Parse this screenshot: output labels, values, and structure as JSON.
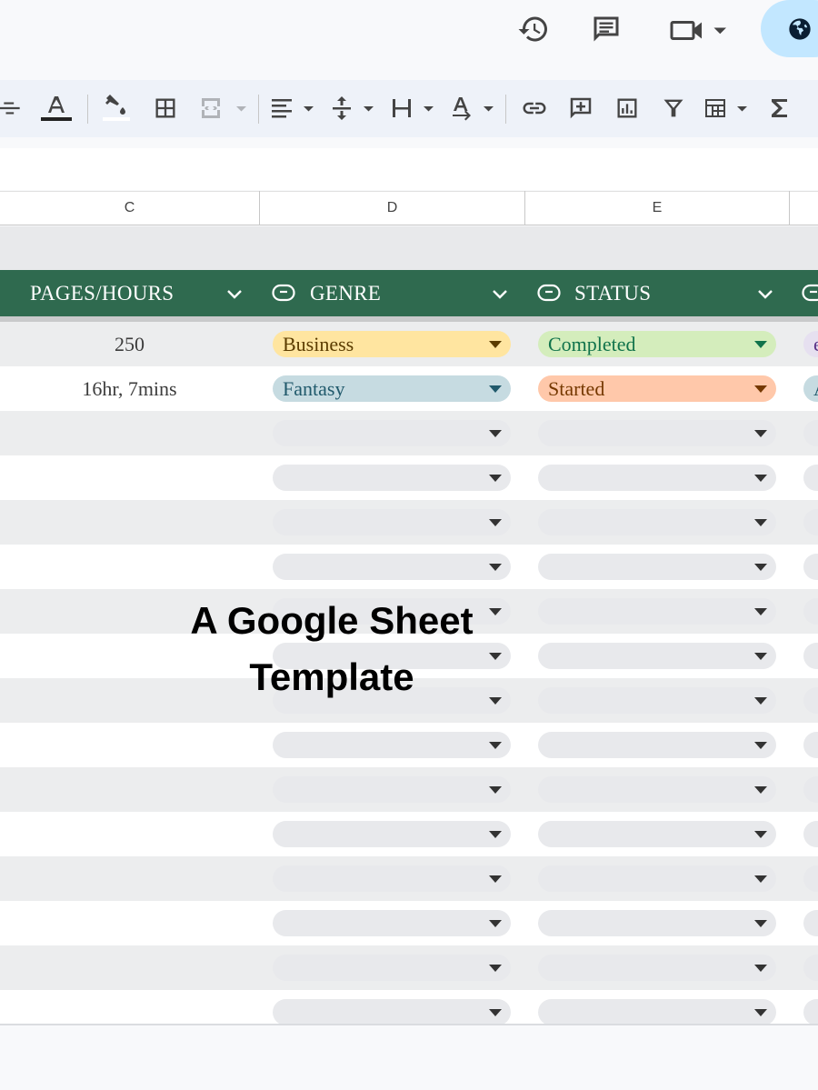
{
  "toolbar_top": {
    "icons": [
      "history-icon",
      "comment-icon",
      "meet-icon",
      "globe-icon"
    ]
  },
  "columns": {
    "c": "C",
    "d": "D",
    "e": "E"
  },
  "header_row": {
    "pages": "PAGES/HOURS",
    "genre": "GENRE",
    "status": "STATUS"
  },
  "rows": [
    {
      "pages": "250",
      "genre": "Business",
      "status": "Completed",
      "next": "e",
      "genre_color": "#ffe5a0",
      "genre_text": "#5b3c00",
      "status_color": "#d4edbc",
      "status_text": "#11734b",
      "next_color": "#e6e0f0",
      "next_text": "#5a3286"
    },
    {
      "pages": "16hr, 7mins",
      "genre": "Fantasy",
      "status": "Started",
      "next": "A",
      "genre_color": "#c6dbe1",
      "genre_text": "#215a6c",
      "status_color": "#ffc8aa",
      "status_text": "#753800",
      "next_color": "#c6dbe1",
      "next_text": "#215a6c"
    }
  ],
  "empty_chip_color": "#e8e9ec",
  "header_color": "#2f6a4f",
  "watermark": {
    "line1": "A Google Sheet",
    "line2": "Template"
  }
}
